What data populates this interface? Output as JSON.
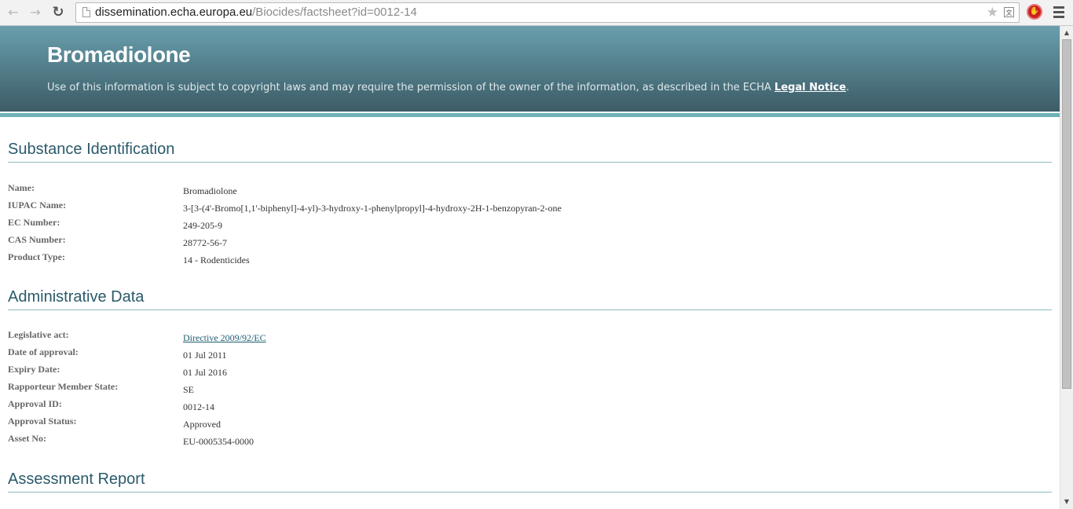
{
  "browser": {
    "url_host": "dissemination.echa.europa.eu",
    "url_path": "/Biocides/factsheet?id=0012-14",
    "back_icon": "←",
    "forward_icon": "→",
    "reload_icon": "↻",
    "star_icon": "★",
    "translate_icon": "文",
    "ext_icon": "✋"
  },
  "banner": {
    "title": "Bromadiolone",
    "notice_prefix": "Use of this information is subject to copyright laws and may require the permission of the owner of the information, as described in the ECHA ",
    "notice_link": "Legal Notice",
    "notice_suffix": "."
  },
  "sections": {
    "identification": {
      "title": "Substance Identification",
      "fields": [
        {
          "label": "Name:",
          "value": "Bromadiolone"
        },
        {
          "label": "IUPAC Name:",
          "value": "3-[3-(4'-Bromo[1,1'-biphenyl]-4-yl)-3-hydroxy-1-phenylpropyl]-4-hydroxy-2H-1-benzopyran-2-one"
        },
        {
          "label": "EC Number:",
          "value": "249-205-9"
        },
        {
          "label": "CAS Number:",
          "value": "28772-56-7"
        },
        {
          "label": "Product Type:",
          "value": "14 - Rodenticides"
        }
      ]
    },
    "administrative": {
      "title": "Administrative Data",
      "fields": [
        {
          "label": "Legislative act:",
          "value": "Directive 2009/92/EC"
        },
        {
          "label": "Date of approval:",
          "value": "01 Jul 2011"
        },
        {
          "label": "Expiry Date:",
          "value": "01 Jul 2016"
        },
        {
          "label": "Rapporteur Member State:",
          "value": "SE"
        },
        {
          "label": "Approval ID:",
          "value": "0012-14"
        },
        {
          "label": "Approval Status:",
          "value": "Approved"
        },
        {
          "label": "Asset No:",
          "value": "EU-0005354-0000"
        }
      ]
    },
    "assessment": {
      "title": "Assessment Report"
    }
  },
  "scrollbar": {
    "up_arrow": "▲",
    "down_arrow": "▼"
  }
}
